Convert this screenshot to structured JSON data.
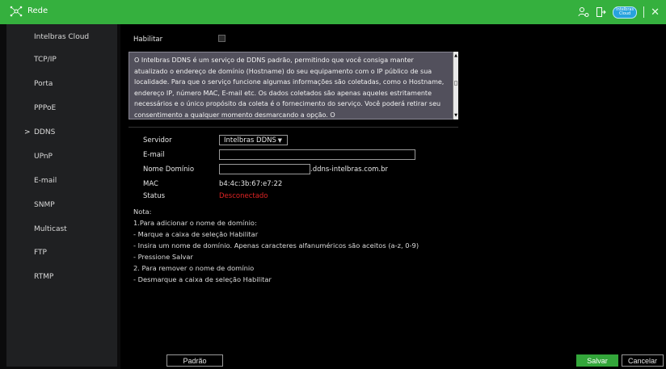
{
  "app": {
    "title": "Rede",
    "cloud_badge": "Intelbras Cloud"
  },
  "colors": {
    "topbar": "#35b03e",
    "sidebar": "#1f2022",
    "accent_save": "#33a63a",
    "status_disconnected": "#e02424"
  },
  "sidebar": {
    "items": [
      {
        "label": "Intelbras Cloud"
      },
      {
        "label": "TCP/IP"
      },
      {
        "label": "Porta"
      },
      {
        "label": "PPPoE"
      },
      {
        "label": "DDNS",
        "active": true
      },
      {
        "label": "UPnP"
      },
      {
        "label": "E-mail"
      },
      {
        "label": "SNMP"
      },
      {
        "label": "Multicast"
      },
      {
        "label": "FTP"
      },
      {
        "label": "RTMP"
      }
    ],
    "active_marker": ">"
  },
  "form": {
    "enable_label": "Habilitar",
    "enable_checked": false,
    "description": "O Intelbras DDNS é um serviço de DDNS padrão, permitindo que você consiga manter atualizado o endereço de domínio (Hostname) do seu equipamento com o IP público de sua localidade. Para que o serviço funcione algumas informações são coletadas, como o Hostname, endereço IP, número MAC, E-mail etc. Os dados coletados são apenas aqueles estritamente necessários e o único propósito da coleta é o fornecimento do serviço. Você poderá retirar seu consentimento a qualquer momento desmarcando a opção. O",
    "server_label": "Servidor",
    "server_value": "Intelbras DDNS",
    "email_label": "E-mail",
    "email_value": "",
    "domain_label": "Nome Domínio",
    "domain_value": "",
    "domain_suffix": ".ddns-intelbras.com.br",
    "mac_label": "MAC",
    "mac_value": "b4:4c:3b:67:e7:22",
    "status_label": "Status",
    "status_value": "Desconectado"
  },
  "notes": [
    "Nota:",
    "1.Para adicionar o nome de domínio:",
    " - Marque a caixa de seleção Habilitar",
    " - Insira um nome de domínio. Apenas caracteres alfanuméricos são aceitos (a-z, 0-9)",
    " - Pressione Salvar",
    "2. Para remover o nome de domínio",
    " - Desmarque a caixa de seleção Habilitar"
  ],
  "buttons": {
    "default": "Padrão",
    "save": "Salvar",
    "cancel": "Cancelar"
  },
  "icons": {
    "logo": "network-icon",
    "user": "user-settings-icon",
    "logout": "logout-icon",
    "cloud": "intelbras-cloud-icon",
    "close": "close-icon"
  }
}
